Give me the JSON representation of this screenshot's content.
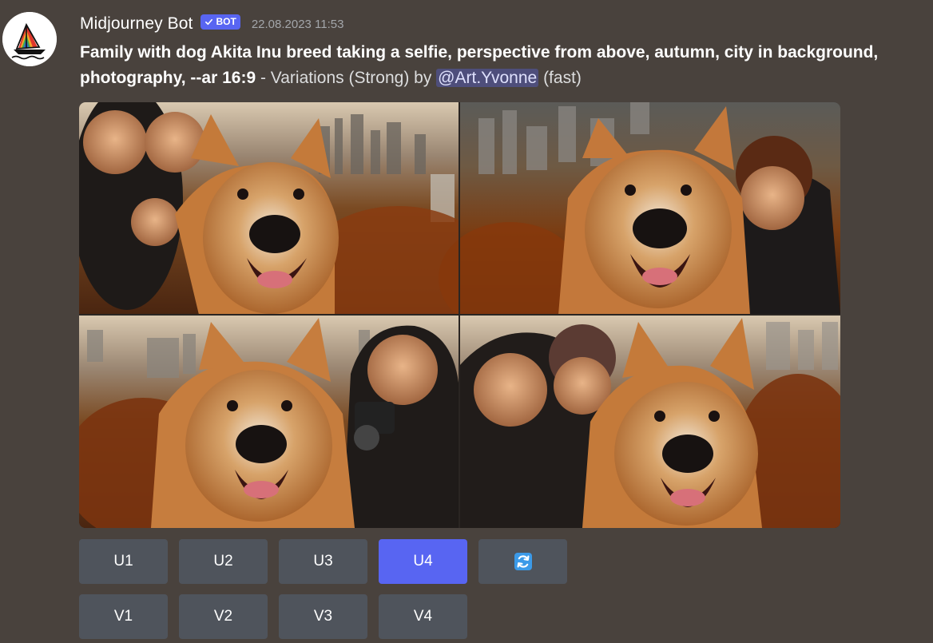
{
  "message": {
    "author": "Midjourney Bot",
    "badge": "BOT",
    "timestamp": "22.08.2023 11:53",
    "prompt": "Family with dog Akita Inu breed taking a selfie, perspective from above, autumn, city in background, photography, --ar 16:9",
    "suffix_before": " - Variations (Strong) by ",
    "mention": "@Art.Yvonne",
    "suffix_after": " (fast)"
  },
  "upscale_buttons": [
    "U1",
    "U2",
    "U3",
    "U4"
  ],
  "active_upscale": "U4",
  "reroll_icon": "refresh-icon",
  "variation_buttons": [
    "V1",
    "V2",
    "V3",
    "V4"
  ],
  "colors": {
    "background": "#49423d",
    "button": "#4f545c",
    "button_active": "#5865f2",
    "reroll_icon": "#3b9ae8",
    "mention_bg": "#5865f2"
  }
}
